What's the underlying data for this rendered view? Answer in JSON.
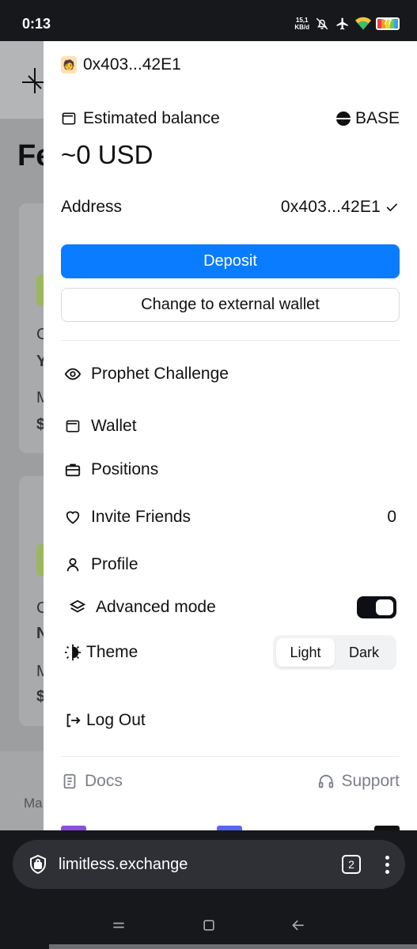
{
  "status_bar": {
    "time": "0:13",
    "net_speed_value": "15,1",
    "net_speed_unit": "KB/d",
    "battery_level": "77"
  },
  "background_page": {
    "title_fragment": "Fe",
    "card_letters": [
      "C",
      "Y",
      "M",
      "$",
      "C",
      "N",
      "M",
      "$"
    ],
    "nav_fragment": "Ma"
  },
  "drawer": {
    "account": {
      "avatar": "🧑",
      "address_short": "0x403...42E1"
    },
    "estimated_balance_label": "Estimated balance",
    "network": "BASE",
    "balance": "~0 USD",
    "address_label": "Address",
    "address_value": "0x403...42E1",
    "deposit_label": "Deposit",
    "change_wallet_label": "Change to external wallet",
    "menu": {
      "prophet": "Prophet Challenge",
      "wallet": "Wallet",
      "positions": "Positions",
      "invite": "Invite Friends",
      "invite_count": "0",
      "profile": "Profile",
      "advanced": "Advanced mode",
      "theme": "Theme",
      "theme_light": "Light",
      "theme_dark": "Dark",
      "logout": "Log Out"
    },
    "advanced_mode_on": true,
    "theme_selected": "Light",
    "footer": {
      "docs": "Docs",
      "support": "Support"
    }
  },
  "browser": {
    "url": "limitless.exchange",
    "tab_count": "2"
  },
  "colors": {
    "accent": "#0a7cff",
    "toggle_on": "#0d0f14"
  }
}
